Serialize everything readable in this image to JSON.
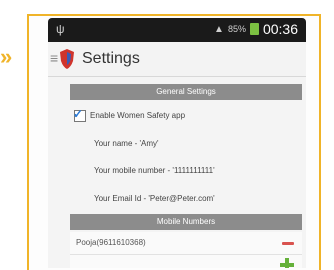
{
  "status": {
    "left_icon": "usb-icon",
    "indicators": "▲▼",
    "battery_text": "85%",
    "time": "00:36"
  },
  "appbar": {
    "title": "Settings",
    "menu_icon": "menu-icon",
    "logo_icon": "shield-icon"
  },
  "general_settings": {
    "header": "General Settings",
    "enable_label": "Enable Women Safety app",
    "enabled": true,
    "name": "Your name - 'Amy'",
    "mobile": "Your mobile number - '1111111111'",
    "email": "Your Email Id - 'Peter@Peter.com'"
  },
  "mobile_numbers": {
    "header": "Mobile Numbers",
    "items": [
      {
        "value": "Pooja(9611610368)"
      }
    ]
  },
  "colors": {
    "accent_border": "#f0b429",
    "status_bar": "#1a1a1a",
    "header_grey": "#8c8c8c",
    "remove": "#d9534f",
    "add": "#65b13a"
  }
}
